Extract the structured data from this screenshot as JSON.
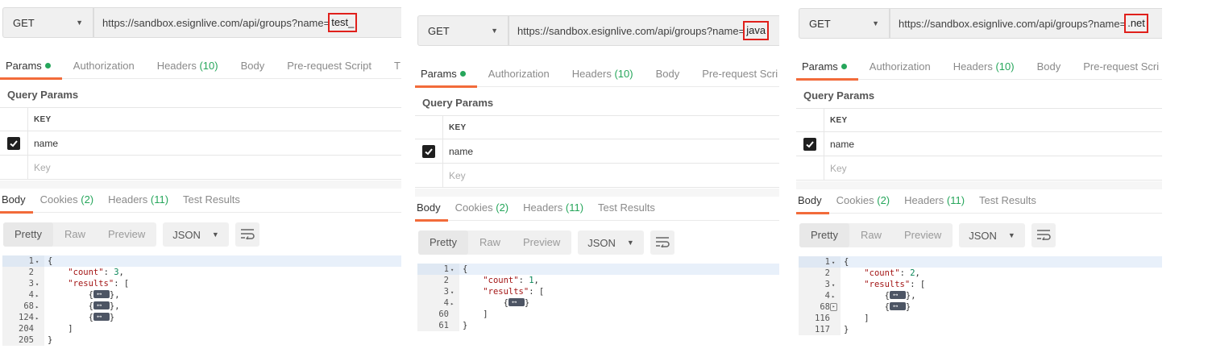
{
  "panels": [
    {
      "method": "GET",
      "url_prefix": "https://sandbox.esignlive.com/api/groups?name=",
      "url_highlight": "test_",
      "request_tabs": [
        {
          "label": "Params",
          "count": "",
          "dot": true,
          "active": true
        },
        {
          "label": "Authorization",
          "count": ""
        },
        {
          "label": "Headers",
          "count": "(10)"
        },
        {
          "label": "Body",
          "count": ""
        },
        {
          "label": "Pre-request Script",
          "count": ""
        },
        {
          "label": "T",
          "count": ""
        }
      ],
      "query_params_title": "Query Params",
      "kv_header": "KEY",
      "param_name": "name",
      "key_placeholder": "Key",
      "response_tabs": [
        {
          "label": "Body",
          "count": "",
          "active": true
        },
        {
          "label": "Cookies",
          "count": "(2)"
        },
        {
          "label": "Headers",
          "count": "(11)"
        },
        {
          "label": "Test Results",
          "count": ""
        }
      ],
      "view_modes": [
        "Pretty",
        "Raw",
        "Preview"
      ],
      "format": "JSON",
      "code": [
        {
          "ln": "1",
          "fold": "▾",
          "text": "{",
          "cur": true
        },
        {
          "ln": "2",
          "fold": "",
          "text": "    \"count\": 3,"
        },
        {
          "ln": "3",
          "fold": "▾",
          "text": "    \"results\": ["
        },
        {
          "ln": "4",
          "fold": "▸",
          "text": "        {⟷},"
        },
        {
          "ln": "68",
          "fold": "▸",
          "text": "        {⟷},"
        },
        {
          "ln": "124",
          "fold": "▸",
          "text": "        {⟷}"
        },
        {
          "ln": "204",
          "fold": "",
          "text": "    ]"
        },
        {
          "ln": "205",
          "fold": "",
          "text": "}"
        }
      ]
    },
    {
      "method": "GET",
      "url_prefix": "https://sandbox.esignlive.com/api/groups?name=",
      "url_highlight": "java",
      "request_tabs": [
        {
          "label": "Params",
          "count": "",
          "dot": true,
          "active": true
        },
        {
          "label": "Authorization",
          "count": ""
        },
        {
          "label": "Headers",
          "count": "(10)"
        },
        {
          "label": "Body",
          "count": ""
        },
        {
          "label": "Pre-request Scri",
          "count": ""
        }
      ],
      "query_params_title": "Query Params",
      "kv_header": "KEY",
      "param_name": "name",
      "key_placeholder": "Key",
      "response_tabs": [
        {
          "label": "Body",
          "count": "",
          "active": true
        },
        {
          "label": "Cookies",
          "count": "(2)"
        },
        {
          "label": "Headers",
          "count": "(11)"
        },
        {
          "label": "Test Results",
          "count": ""
        }
      ],
      "view_modes": [
        "Pretty",
        "Raw",
        "Preview"
      ],
      "format": "JSON",
      "code": [
        {
          "ln": "1",
          "fold": "▾",
          "text": "{",
          "cur": true
        },
        {
          "ln": "2",
          "fold": "",
          "text": "    \"count\": 1,"
        },
        {
          "ln": "3",
          "fold": "▾",
          "text": "    \"results\": ["
        },
        {
          "ln": "4",
          "fold": "▸",
          "text": "        {⟷}"
        },
        {
          "ln": "60",
          "fold": "",
          "text": "    ]"
        },
        {
          "ln": "61",
          "fold": "",
          "text": "}"
        }
      ]
    },
    {
      "method": "GET",
      "url_prefix": "https://sandbox.esignlive.com/api/groups?name=",
      "url_highlight": ".net",
      "request_tabs": [
        {
          "label": "Params",
          "count": "",
          "dot": true,
          "active": true
        },
        {
          "label": "Authorization",
          "count": ""
        },
        {
          "label": "Headers",
          "count": "(10)"
        },
        {
          "label": "Body",
          "count": ""
        },
        {
          "label": "Pre-request Scri",
          "count": ""
        }
      ],
      "query_params_title": "Query Params",
      "kv_header": "KEY",
      "param_name": "name",
      "key_placeholder": "Key",
      "response_tabs": [
        {
          "label": "Body",
          "count": "",
          "active": true
        },
        {
          "label": "Cookies",
          "count": "(2)"
        },
        {
          "label": "Headers",
          "count": "(11)"
        },
        {
          "label": "Test Results",
          "count": ""
        }
      ],
      "view_modes": [
        "Pretty",
        "Raw",
        "Preview"
      ],
      "format": "JSON",
      "code": [
        {
          "ln": "1",
          "fold": "▾",
          "text": "{",
          "cur": true
        },
        {
          "ln": "2",
          "fold": "",
          "text": "    \"count\": 2,"
        },
        {
          "ln": "3",
          "fold": "▾",
          "text": "    \"results\": ["
        },
        {
          "ln": "4",
          "fold": "▸",
          "text": "        {⟷},"
        },
        {
          "ln": "68",
          "fold": "▸",
          "text": "        {⟷}",
          "box": true
        },
        {
          "ln": "116",
          "fold": "",
          "text": "    ]"
        },
        {
          "ln": "117",
          "fold": "",
          "text": "}"
        }
      ]
    }
  ]
}
